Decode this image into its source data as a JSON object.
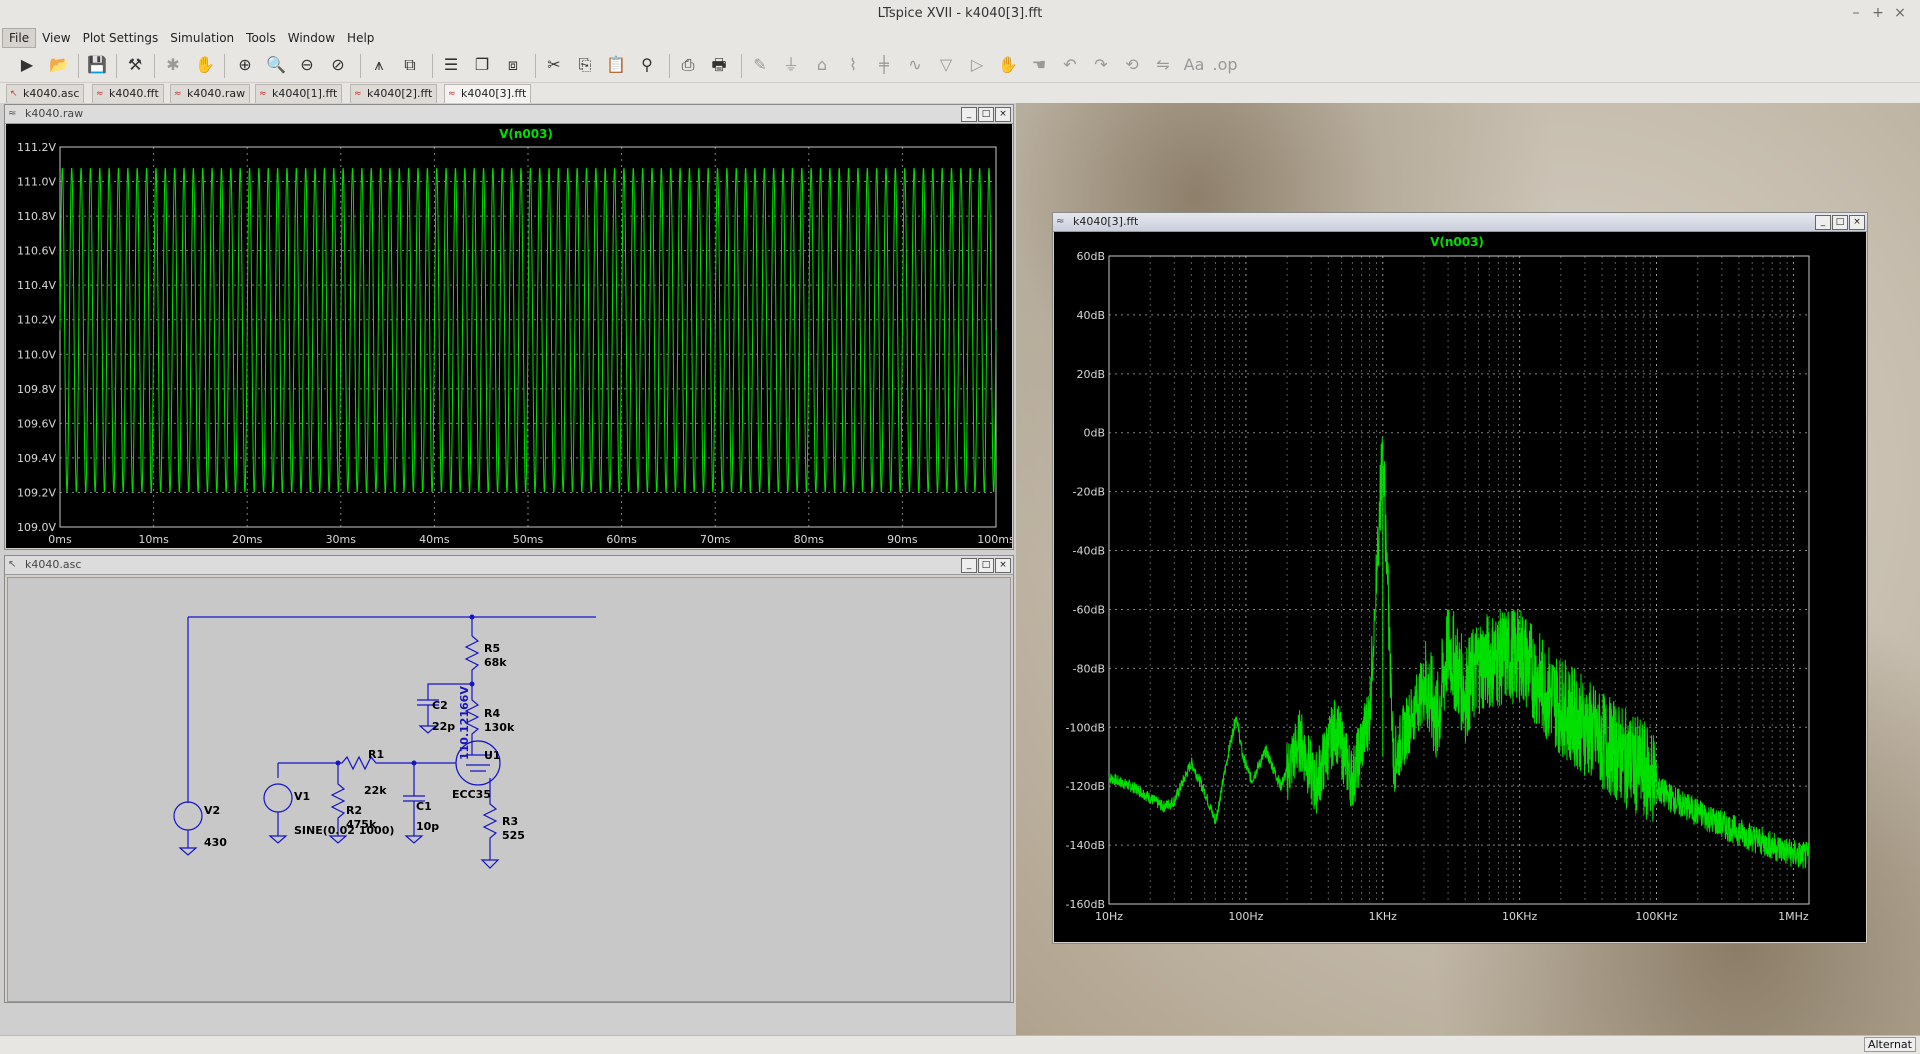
{
  "window": {
    "title": "LTspice XVII - k4040[3].fft"
  },
  "menu": [
    "File",
    "View",
    "Plot Settings",
    "Simulation",
    "Tools",
    "Window",
    "Help"
  ],
  "toolbar": [
    "run-icon",
    "open-icon",
    "save-icon",
    "control-panel-icon",
    "halt-icon",
    "pan-icon",
    "zoom-in-icon",
    "zoom-area-icon",
    "zoom-out-icon",
    "zoom-cancel-icon",
    "autorange-icon",
    "manual-limits-icon",
    "tile-horizontal-icon",
    "cascade-icon",
    "tile-vertical-icon",
    "cut-icon",
    "copy-icon",
    "paste-icon",
    "find-icon",
    "print-setup-icon",
    "print-icon",
    "draw-wire-icon",
    "ground-icon",
    "label-icon",
    "resistor-icon",
    "capacitor-icon",
    "inductor-icon",
    "diode-icon",
    "component-icon",
    "move-icon",
    "drag-icon",
    "undo-icon",
    "redo-icon",
    "rotate-icon",
    "mirror-icon",
    "text-icon",
    "spice-directive-icon"
  ],
  "tabs": [
    "k4040.asc",
    "k4040.fft",
    "k4040.raw",
    "k4040[1].fft",
    "k4040[2].fft",
    "k4040[3].fft"
  ],
  "raw_window": {
    "title": "k4040.raw",
    "trace": "V(n003)",
    "colors": {
      "trace": "#00e000",
      "grid": "#9a9a9a",
      "axis": "#c8c8c8"
    },
    "chart_data": {
      "type": "line",
      "title": "V(n003)",
      "xlabel": "",
      "ylabel": "",
      "x_ticks": [
        "0ms",
        "10ms",
        "20ms",
        "30ms",
        "40ms",
        "50ms",
        "60ms",
        "70ms",
        "80ms",
        "90ms",
        "100ms"
      ],
      "y_ticks": [
        "111.2V",
        "111.0V",
        "110.8V",
        "110.6V",
        "110.4V",
        "110.2V",
        "110.0V",
        "109.8V",
        "109.6V",
        "109.4V",
        "109.2V",
        "109.0V"
      ],
      "xlim": [
        0,
        100
      ],
      "ylim": [
        109.0,
        111.2
      ],
      "series": [
        {
          "name": "V(n003)",
          "waveform": "sine",
          "frequency_hz": 1000,
          "min": 109.2,
          "max": 111.08
        }
      ],
      "grid": true
    }
  },
  "fft_window": {
    "title": "k4040[3].fft",
    "trace": "V(n003)",
    "chart_data": {
      "type": "line",
      "title": "V(n003)",
      "xlabel": "",
      "ylabel": "",
      "x_scale": "log",
      "x_ticks": [
        "10Hz",
        "100Hz",
        "1KHz",
        "10KHz",
        "100KHz",
        "1MHz"
      ],
      "y_ticks": [
        "60dB",
        "40dB",
        "20dB",
        "0dB",
        "-20dB",
        "-40dB",
        "-60dB",
        "-80dB",
        "-100dB",
        "-120dB",
        "-140dB",
        "-160dB"
      ],
      "xlim": [
        10,
        1300000
      ],
      "ylim": [
        -160,
        60
      ],
      "series": [
        {
          "name": "V(n003)",
          "points": [
            [
              10,
              -117
            ],
            [
              16,
              -121
            ],
            [
              25,
              -127
            ],
            [
              30,
              -125
            ],
            [
              40,
              -112
            ],
            [
              50,
              -122
            ],
            [
              60,
              -132
            ],
            [
              75,
              -108
            ],
            [
              85,
              -96
            ],
            [
              95,
              -110
            ],
            [
              110,
              -118
            ],
            [
              140,
              -108
            ],
            [
              180,
              -120
            ],
            [
              250,
              -104
            ],
            [
              320,
              -120
            ],
            [
              450,
              -100
            ],
            [
              600,
              -118
            ],
            [
              800,
              -95
            ],
            [
              1000,
              -4
            ],
            [
              1200,
              -112
            ],
            [
              1500,
              -100
            ],
            [
              2000,
              -86
            ],
            [
              2500,
              -102
            ],
            [
              3000,
              -75
            ],
            [
              4000,
              -92
            ],
            [
              5000,
              -82
            ],
            [
              7000,
              -80
            ],
            [
              10000,
              -78
            ],
            [
              15000,
              -90
            ],
            [
              20000,
              -96
            ],
            [
              40000,
              -108
            ],
            [
              80000,
              -118
            ],
            [
              150000,
              -126
            ],
            [
              300000,
              -133
            ],
            [
              600000,
              -139
            ],
            [
              1000000,
              -143
            ],
            [
              1300000,
              -144
            ]
          ]
        }
      ],
      "grid": true
    }
  },
  "schematic": {
    "title": "k4040.asc",
    "components": [
      {
        "ref": "R5",
        "value": "68k"
      },
      {
        "ref": "R4",
        "value": "130k"
      },
      {
        "ref": "C2",
        "value": "22p"
      },
      {
        "ref": "R1",
        "value": "22k"
      },
      {
        "ref": "C1",
        "value": "10p"
      },
      {
        "ref": "R2",
        "value": "475k"
      },
      {
        "ref": "R3",
        "value": "525"
      },
      {
        "ref": "V1",
        "value": "SINE(0.02 1000)"
      },
      {
        "ref": "V2",
        "value": "430"
      },
      {
        "ref": "U1",
        "value": "ECC35"
      }
    ],
    "node_voltage": "110.12166V"
  },
  "status": {
    "mode": "Alternat"
  }
}
